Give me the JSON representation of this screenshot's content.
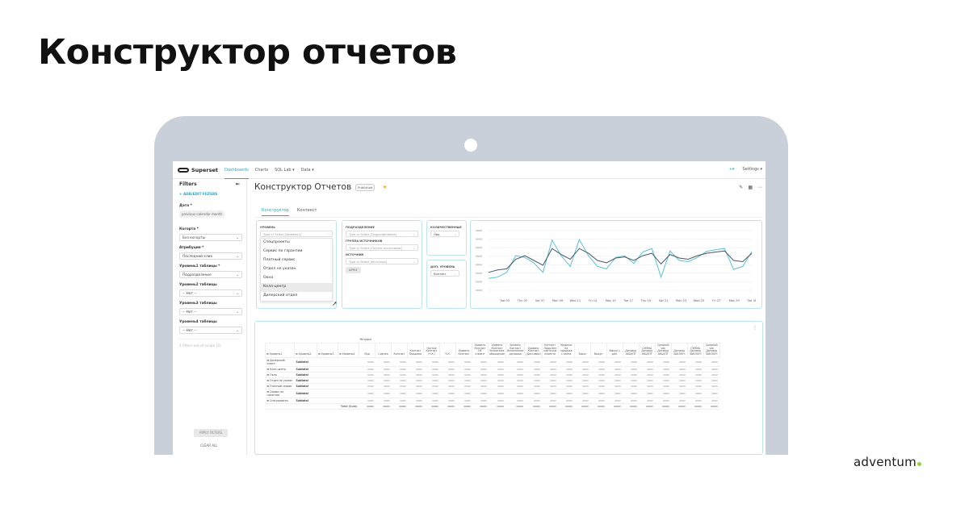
{
  "page": {
    "title": "Конструктор отчетов",
    "brand": "adventum",
    "brand_dot_color": "#9ccf3c"
  },
  "superset": {
    "logo": "Superset",
    "nav": [
      "Dashboards",
      "Charts",
      "SQL Lab ▾",
      "Data ▾"
    ],
    "nav_right": [
      "+▾",
      "Settings ▾"
    ],
    "accent": "#20a7c9"
  },
  "sidebar": {
    "title": "Filters",
    "collapse_icon": "⇤",
    "add_filters": "+ ADD/EDIT FILTERS",
    "filters": [
      {
        "label": "Дата *",
        "value": "previous calendar month",
        "kind": "chip"
      },
      {
        "label": "Когорта *",
        "value": "Без когорты",
        "kind": "select"
      },
      {
        "label": "Атрибуция *",
        "value": "Последний клик",
        "kind": "select"
      },
      {
        "label": "Уровень1 таблицы *",
        "value": "Подразделение",
        "kind": "select"
      },
      {
        "label": "Уровень2 таблицы",
        "value": "-- Нет --",
        "kind": "select"
      },
      {
        "label": "Уровень3 таблицы",
        "value": "-- Нет --",
        "kind": "select"
      },
      {
        "label": "Уровень4 таблицы",
        "value": "-- Нет --",
        "kind": "select"
      }
    ],
    "out_of_scope": "1 filters out of scope (2)",
    "apply": "APPLY FILTERS",
    "clear": "CLEAR ALL"
  },
  "dashboard": {
    "title": "Конструктор Отчетов",
    "badge": "Published",
    "tabs": [
      "Конструктор",
      "Контекст"
    ],
    "active_tab": "Конструктор"
  },
  "panel_levels": {
    "label": "УРОВЕНЬ",
    "placeholder": "Type or Select [Уровень1]",
    "options": [
      "Спецпроекты",
      "Сервис по гарантии",
      "Платный сервис",
      "Отдел не указан",
      "Окна",
      "Колл-центр",
      "Дилерский отдел"
    ],
    "highlighted": "Колл-центр"
  },
  "panel_sources": {
    "labels": [
      "ПОДРАЗДЕЛЕНИЕ",
      "ГРУППА ИСТОЧНИКОВ",
      "ИСТОЧНИК"
    ],
    "placeholders": [
      "Type or Select [Подразделение]",
      "Type or Select [Группа источников]",
      "Type or Select [Источник]"
    ],
    "apply": "APPLY"
  },
  "panel_metrics": {
    "label1": "КОЛИЧЕСТВЕННЫЕ",
    "value1": "Лид",
    "label2": "ДОП. УРОВЕНЬ",
    "value2": "Контакт"
  },
  "chart_data": {
    "type": "line",
    "x": [
      "Tue 03",
      "Thu 05",
      "Sat 07",
      "Mon 09",
      "Wed 11",
      "Fri 13",
      "May 15",
      "Tue 17",
      "Thu 19",
      "Sat 21",
      "Mon 23",
      "Wed 25",
      "Fri 27",
      "May 29",
      "Tue 31"
    ],
    "series": [
      {
        "color": "#5bbfd6",
        "values": [
          20,
          22,
          30,
          58,
          55,
          46,
          30,
          84,
          58,
          40,
          85,
          58,
          40,
          36,
          55,
          58,
          45,
          64,
          70,
          22,
          66,
          50,
          48,
          55,
          65,
          68,
          70,
          35,
          40,
          65
        ]
      },
      {
        "color": "#4a5868",
        "values": [
          30,
          34,
          36,
          52,
          58,
          50,
          42,
          70,
          60,
          52,
          70,
          62,
          50,
          46,
          54,
          56,
          50,
          58,
          62,
          44,
          60,
          54,
          52,
          58,
          62,
          64,
          66,
          50,
          48,
          62
        ]
      }
    ],
    "ylim": [
      0,
      100
    ],
    "grid": true
  },
  "table": {
    "top_header": "Метрика",
    "level_headers": [
      "Уровень1",
      "Уровень2",
      "Уровень3",
      "Уровень4"
    ],
    "columns": [
      "Лид",
      "Сделка",
      "Контакт",
      "Контакт Продажи",
      "Чистые Контакт (Ч.К.)",
      "Ч.К.",
      "Уровень Контакт",
      "Уровень Контакт НЕ клиент",
      "Уровень Контакт Вторичное обращение",
      "Уровень Контакт Исполнение договора",
      "Уровень Контакт (Доставки)",
      "Контакт Лиды без карточки клиента",
      "Надоело по продаже с сайта",
      "Заказ",
      "Выкуп",
      "Выкуп с доп.",
      "Договор АКЦЕПТ",
      "СУММА Договор АКЦЕПТ",
      "Средний чек Договор АКЦЕПТ",
      "Договор ЗАКЛЮЧ",
      "СУММА Договор ЗАКЛЮЧ",
      "Средний чек Договор ЗАКЛЮЧ"
    ],
    "rows": [
      {
        "label": "⊞ Дилерский отдел",
        "subtotal": "Subtotal"
      },
      {
        "label": "⊞ Колл-центр",
        "subtotal": "Subtotal"
      },
      {
        "label": "⊞ Окна",
        "subtotal": "Subtotal"
      },
      {
        "label": "⊞ Отдел не указан",
        "subtotal": "Subtotal"
      },
      {
        "label": "⊞ Платный сервис",
        "subtotal": "Subtotal"
      },
      {
        "label": "⊞ Сервис по гарантии",
        "subtotal": "Subtotal"
      },
      {
        "label": "⊞ Спецпроекты",
        "subtotal": "Subtotal"
      }
    ],
    "total_label": "Total (Sum)"
  }
}
